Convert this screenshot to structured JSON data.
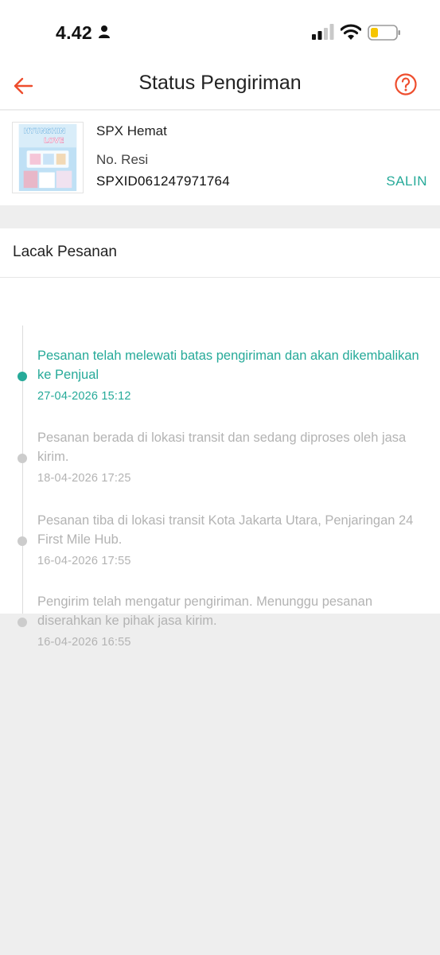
{
  "status_bar": {
    "time": "4.42",
    "icons": [
      "person-icon",
      "signal-icon",
      "wifi-icon",
      "battery-icon"
    ],
    "battery_color": "#f6c500"
  },
  "header": {
    "title": "Status Pengiriman",
    "back_icon": "arrow-left-icon",
    "help_icon": "question-circle-icon",
    "accent_color": "#ee4d2d"
  },
  "shipment": {
    "courier": "SPX Hemat",
    "resi_label": "No. Resi",
    "resi_number": "SPXID061247971764",
    "copy_label": "SALIN",
    "thumbnail_text_1": "HYUNSHIN",
    "thumbnail_text_2": "LOVE"
  },
  "tracking": {
    "title": "Lacak Pesanan",
    "events": [
      {
        "description": "Pesanan telah melewati batas pengiriman dan akan dikembalikan ke Penjual",
        "time": "27-04-2026 15:12",
        "active": true
      },
      {
        "description": "Pesanan berada di lokasi transit dan sedang diproses oleh jasa kirim.",
        "time": "18-04-2026 17:25",
        "active": false
      },
      {
        "description": "Pesanan tiba di lokasi transit Kota Jakarta Utara, Penjaringan 24 First Mile Hub.",
        "time": "16-04-2026 17:55",
        "active": false
      },
      {
        "description": "Pengirim telah mengatur pengiriman. Menunggu pesanan diserahkan ke pihak jasa kirim.",
        "time": "16-04-2026 16:55",
        "active": false
      }
    ],
    "active_color": "#26aa99",
    "inactive_color": "#b3b3b3"
  }
}
